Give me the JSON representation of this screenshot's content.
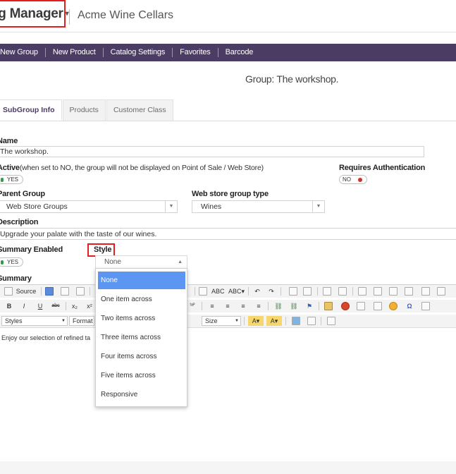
{
  "header": {
    "app_title": "og Manager",
    "title_caret": "▾",
    "company": "Acme Wine Cellars"
  },
  "nav": {
    "items": [
      "New Group",
      "New Product",
      "Catalog Settings",
      "Favorites",
      "Barcode"
    ]
  },
  "page": {
    "heading": "Group: The workshop."
  },
  "tabs": [
    "SubGroup Info",
    "Products",
    "Customer Class"
  ],
  "form": {
    "name_label": "Name",
    "name_value": "The workshop.",
    "active_label": "Active",
    "active_note": "(when set to NO, the group will not be displayed on Point of Sale / Web Store)",
    "active_toggle": "YES",
    "requires_auth_label": "Requires Authentication",
    "requires_auth_toggle": "NO",
    "parent_group_label": "Parent Group",
    "parent_group_value": "Web Store Groups",
    "web_store_type_label": "Web store group type",
    "web_store_type_value": "Wines",
    "description_label": "Description",
    "description_value": "Upgrade your palate with the taste of our wines.",
    "summary_enabled_label": "Summary Enabled",
    "summary_enabled_toggle": "YES",
    "style_label": "Style",
    "summary_label": "Summary",
    "toggle_on_color": "#2e9e45",
    "toggle_off_color": "#d32f2f"
  },
  "editor": {
    "source_label": "Source",
    "styles_label": "Styles",
    "format_label": "Format",
    "size_label": "Size",
    "body_text": "Enjoy our selection of refined ta"
  },
  "style_dropdown": {
    "selected": "None",
    "options": [
      "None",
      "One item across",
      "Two items across",
      "Three items across",
      "Four items across",
      "Five items across",
      "Responsive"
    ],
    "highlight_color": "#5c96f2"
  },
  "colors": {
    "nav_bg": "#4b3c63",
    "highlight_box": "#e21f1f"
  }
}
